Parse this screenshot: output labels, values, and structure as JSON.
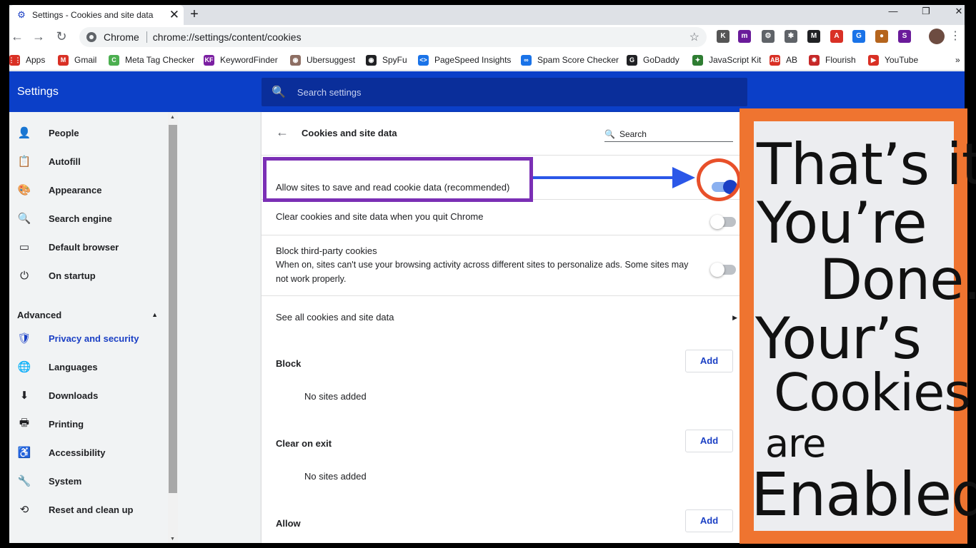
{
  "browser": {
    "tab_title": "Settings - Cookies and site data",
    "tab_close": "✕",
    "new_tab": "+",
    "window_controls": {
      "minimize": "—",
      "restore": "❐",
      "close": "✕"
    },
    "nav": {
      "back": "←",
      "forward": "→",
      "reload": "↻"
    },
    "omnibox": {
      "chip": "Chrome",
      "url": "chrome://settings/content/cookies",
      "star": "☆"
    },
    "extensions": [
      {
        "name": "k-icon",
        "label": "K",
        "color": "#555555"
      },
      {
        "name": "meta-extension-icon",
        "label": "m",
        "color": "#6a1b9a"
      },
      {
        "name": "gear-extension-icon",
        "label": "⚙",
        "color": "#5f6368"
      },
      {
        "name": "puzzle-extension-icon",
        "label": "✱",
        "color": "#5f6368"
      },
      {
        "name": "m-extension-icon",
        "label": "M",
        "color": "#202124"
      },
      {
        "name": "a-extension-icon",
        "label": "A",
        "color": "#d93025"
      },
      {
        "name": "translate-extension-icon",
        "label": "G",
        "color": "#1a73e8"
      },
      {
        "name": "cookie-extension-icon",
        "label": "●",
        "color": "#b5651d"
      },
      {
        "name": "s-extension-icon",
        "label": "S",
        "color": "#6a1b9a"
      }
    ]
  },
  "bookmarks": [
    {
      "name": "bookmark-apps",
      "label": "Apps",
      "icon": "⋮⋮",
      "color": "#d93025"
    },
    {
      "name": "bookmark-gmail",
      "label": "Gmail",
      "icon": "M",
      "color": "#d93025"
    },
    {
      "name": "bookmark-meta-tag-checker",
      "label": "Meta Tag Checker",
      "icon": "C",
      "color": "#4caf50"
    },
    {
      "name": "bookmark-keywordfinder",
      "label": "KeywordFinder",
      "icon": "KF",
      "color": "#7b1fa2"
    },
    {
      "name": "bookmark-ubersuggest",
      "label": "Ubersuggest",
      "icon": "◉",
      "color": "#8d6e63"
    },
    {
      "name": "bookmark-spyfu",
      "label": "SpyFu",
      "icon": "◉",
      "color": "#202124"
    },
    {
      "name": "bookmark-pagespeed-insights",
      "label": "PageSpeed Insights",
      "icon": "<>",
      "color": "#1a73e8"
    },
    {
      "name": "bookmark-spam-score-checker",
      "label": "Spam Score Checker",
      "icon": "∞",
      "color": "#1a73e8"
    },
    {
      "name": "bookmark-godaddy",
      "label": "GoDaddy",
      "icon": "G",
      "color": "#202124"
    },
    {
      "name": "bookmark-javascript-kit",
      "label": "JavaScript Kit",
      "icon": "✦",
      "color": "#2e7d32"
    },
    {
      "name": "bookmark-ab",
      "label": "AB",
      "icon": "AB",
      "color": "#d93025"
    },
    {
      "name": "bookmark-flourish",
      "label": "Flourish",
      "icon": "✹",
      "color": "#c62828"
    },
    {
      "name": "bookmark-youtube",
      "label": "YouTube",
      "icon": "▶",
      "color": "#d93025"
    }
  ],
  "bookmarks_overflow": "»",
  "settings": {
    "title": "Settings",
    "search_placeholder": "Search settings"
  },
  "sidebar": {
    "items": [
      {
        "name": "sidebar-item-people",
        "label": "People",
        "icon": "person-icon",
        "glyph": "👤"
      },
      {
        "name": "sidebar-item-autofill",
        "label": "Autofill",
        "icon": "clipboard-icon",
        "glyph": "📋"
      },
      {
        "name": "sidebar-item-appearance",
        "label": "Appearance",
        "icon": "palette-icon",
        "glyph": "🎨"
      },
      {
        "name": "sidebar-item-search-engine",
        "label": "Search engine",
        "icon": "search-icon",
        "glyph": "🔍"
      },
      {
        "name": "sidebar-item-default-browser",
        "label": "Default browser",
        "icon": "browser-icon",
        "glyph": "▭"
      },
      {
        "name": "sidebar-item-on-startup",
        "label": "On startup",
        "icon": "power-icon",
        "glyph": "⏻"
      }
    ],
    "advanced_label": "Advanced",
    "advanced_items": [
      {
        "name": "sidebar-item-privacy-and-security",
        "label": "Privacy and security",
        "icon": "shield-icon",
        "glyph": "🛡",
        "active": true
      },
      {
        "name": "sidebar-item-languages",
        "label": "Languages",
        "icon": "globe-icon",
        "glyph": "🌐"
      },
      {
        "name": "sidebar-item-downloads",
        "label": "Downloads",
        "icon": "download-icon",
        "glyph": "⬇"
      },
      {
        "name": "sidebar-item-printing",
        "label": "Printing",
        "icon": "printer-icon",
        "glyph": "🖶"
      },
      {
        "name": "sidebar-item-accessibility",
        "label": "Accessibility",
        "icon": "accessibility-icon",
        "glyph": "♿"
      },
      {
        "name": "sidebar-item-system",
        "label": "System",
        "icon": "wrench-icon",
        "glyph": "🔧"
      },
      {
        "name": "sidebar-item-reset-and-clean-up",
        "label": "Reset and clean up",
        "icon": "history-icon",
        "glyph": "⟲"
      }
    ]
  },
  "main": {
    "page_title": "Cookies and site data",
    "search_placeholder": "Search",
    "allow_cookies_label": "Allow sites to save and read cookie data (recommended)",
    "allow_cookies_on": true,
    "clear_on_quit_label": "Clear cookies and site data when you quit Chrome",
    "clear_on_quit_on": false,
    "block_third_party_label": "Block third-party cookies",
    "block_third_party_desc": "When on, sites can't use your browsing activity across different sites to personalize ads. Some sites may not work properly.",
    "block_third_party_on": false,
    "see_all_label": "See all cookies and site data",
    "block_section": "Block",
    "clear_on_exit_section": "Clear on exit",
    "allow_section": "Allow",
    "add_label": "Add",
    "no_sites_label": "No sites added"
  },
  "note": {
    "line1": "That’s it",
    "line2": "You’re",
    "line3": "Done.",
    "line4": "Your’s",
    "line5": "Cookies",
    "line6": "are",
    "line7": "Enabled."
  }
}
